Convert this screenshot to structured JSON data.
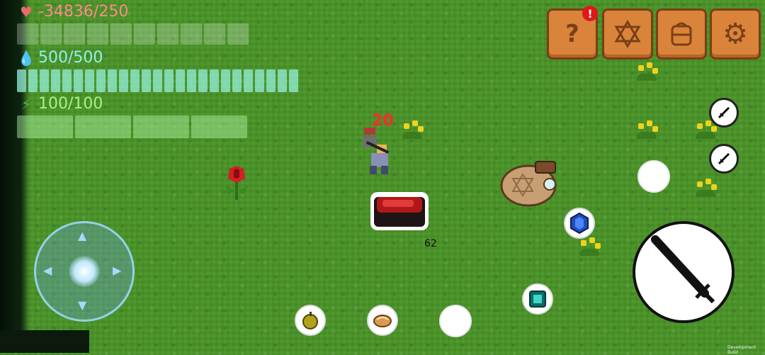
{
  "hud": {
    "hp_text": "-34836/250",
    "mp_text": "500/500",
    "stamina_text": "100/100",
    "hp_bar": {
      "segments": 10,
      "fill_fraction": 0
    },
    "mp_bar": {
      "segments": 25,
      "fill_fraction": 1
    },
    "stamina_bar": {
      "segments": 4,
      "fill_fraction": 1
    }
  },
  "menu": {
    "help_symbol": "?",
    "alert_symbol": "!",
    "buttons": [
      "help",
      "star",
      "backpack",
      "settings"
    ]
  },
  "world": {
    "damage_text": "20",
    "item_count": "62"
  },
  "footer": {
    "build_label": "Development Build"
  },
  "colors": {
    "grass": "#4f9a2c",
    "button_orange": "#d9843a",
    "hp": "#ff8a8a",
    "mp": "#8ff0f0",
    "stamina": "#a6f28a"
  }
}
